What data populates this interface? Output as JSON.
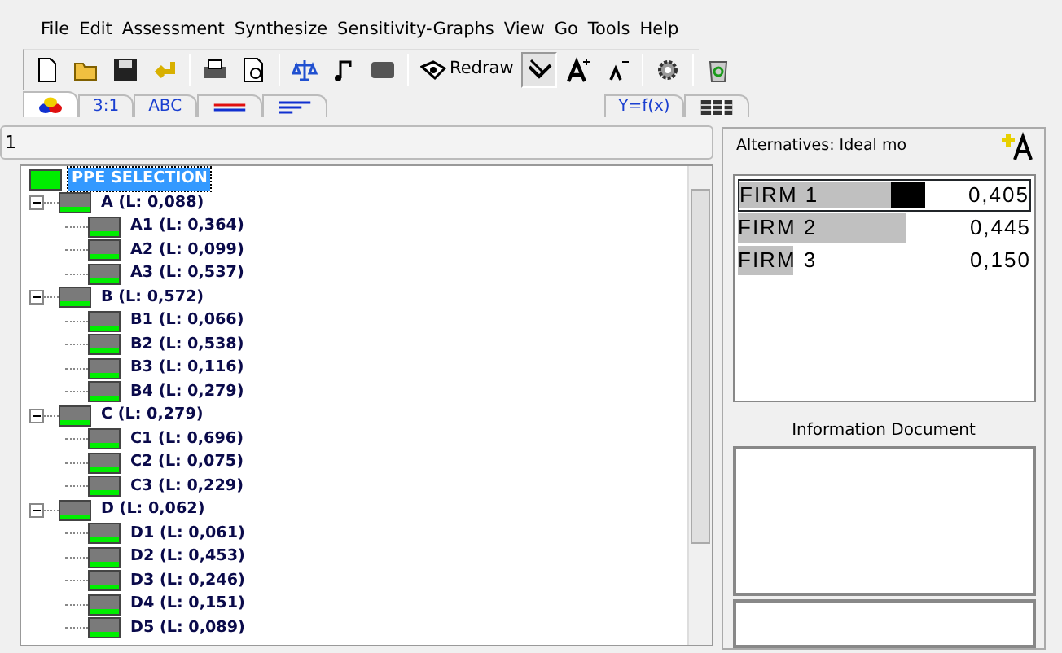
{
  "menu": [
    "File",
    "Edit",
    "Assessment",
    "Synthesize",
    "Sensitivity-Graphs",
    "View",
    "Go",
    "Tools",
    "Help"
  ],
  "toolbar": [
    {
      "kind": "icon",
      "pressed": false
    },
    {
      "kind": "icon",
      "pressed": false
    },
    {
      "kind": "icon",
      "pressed": false
    },
    {
      "kind": "icon",
      "pressed": false
    },
    {
      "kind": "sep"
    },
    {
      "kind": "icon",
      "pressed": false
    },
    {
      "kind": "icon",
      "pressed": false
    },
    {
      "kind": "sep"
    },
    {
      "kind": "icon",
      "pressed": false
    },
    {
      "kind": "icon",
      "pressed": false
    },
    {
      "kind": "icon",
      "pressed": false
    },
    {
      "kind": "sep"
    },
    {
      "kind": "text",
      "label": "Redraw",
      "pressed": false
    },
    {
      "kind": "icon",
      "pressed": true
    },
    {
      "kind": "icon",
      "pressed": false
    },
    {
      "kind": "icon",
      "pressed": false
    },
    {
      "kind": "sep"
    },
    {
      "kind": "icon",
      "pressed": false
    },
    {
      "kind": "sep"
    },
    {
      "kind": "icon",
      "pressed": false
    }
  ],
  "tabs": [
    {
      "kind": "shapes",
      "selected": true
    },
    {
      "kind": "text",
      "label": "3:1",
      "selected": false
    },
    {
      "kind": "text",
      "label": "ABC",
      "selected": false
    },
    {
      "kind": "lines",
      "selected": false
    },
    {
      "kind": "bars",
      "selected": false
    },
    {
      "kind": "text",
      "label": "Y=f(x)",
      "selected": false
    },
    {
      "kind": "grid",
      "selected": false
    }
  ],
  "input": {
    "value": "1"
  },
  "tree": [
    {
      "label": "PPE SELECTION",
      "selected": true,
      "children": [
        {
          "label": "A (L: 0,088)",
          "selected": false,
          "expanded": true,
          "children": [
            {
              "label": "A1 (L: 0,364)",
              "selected": false
            },
            {
              "label": "A2 (L: 0,099)",
              "selected": false
            },
            {
              "label": "A3 (L: 0,537)",
              "selected": false
            }
          ]
        },
        {
          "label": "B (L: 0,572)",
          "selected": false,
          "expanded": true,
          "children": [
            {
              "label": "B1 (L: 0,066)",
              "selected": false
            },
            {
              "label": "B2 (L: 0,538)",
              "selected": false
            },
            {
              "label": "B3 (L: 0,116)",
              "selected": false
            },
            {
              "label": "B4 (L: 0,279)",
              "selected": false
            }
          ]
        },
        {
          "label": "C (L: 0,279)",
          "selected": false,
          "expanded": true,
          "children": [
            {
              "label": "C1 (L: 0,696)",
              "selected": false
            },
            {
              "label": "C2 (L: 0,075)",
              "selected": false
            },
            {
              "label": "C3 (L: 0,229)",
              "selected": false
            }
          ]
        },
        {
          "label": "D (L: 0,062)",
          "selected": false,
          "expanded": true,
          "children": [
            {
              "label": "D1 (L: 0,061)",
              "selected": false
            },
            {
              "label": "D2 (L: 0,453)",
              "selected": false
            },
            {
              "label": "D3 (L: 0,246)",
              "selected": false
            },
            {
              "label": "D4 (L: 0,151)",
              "selected": false
            },
            {
              "label": "D5 (L: 0,089)",
              "selected": false
            }
          ]
        }
      ]
    }
  ],
  "alternatives_link": "Alternatives: Ideal mo",
  "alternatives": [
    {
      "name": "FIRM 1",
      "value": "0,405",
      "level": 0.64,
      "selected": true
    },
    {
      "name": "FIRM 2",
      "value": "0,445",
      "level": 0.57,
      "selected": false
    },
    {
      "name": "FIRM 3",
      "value": "0,150",
      "level": 0.19,
      "selected": false
    }
  ],
  "info_title": "Information Document"
}
